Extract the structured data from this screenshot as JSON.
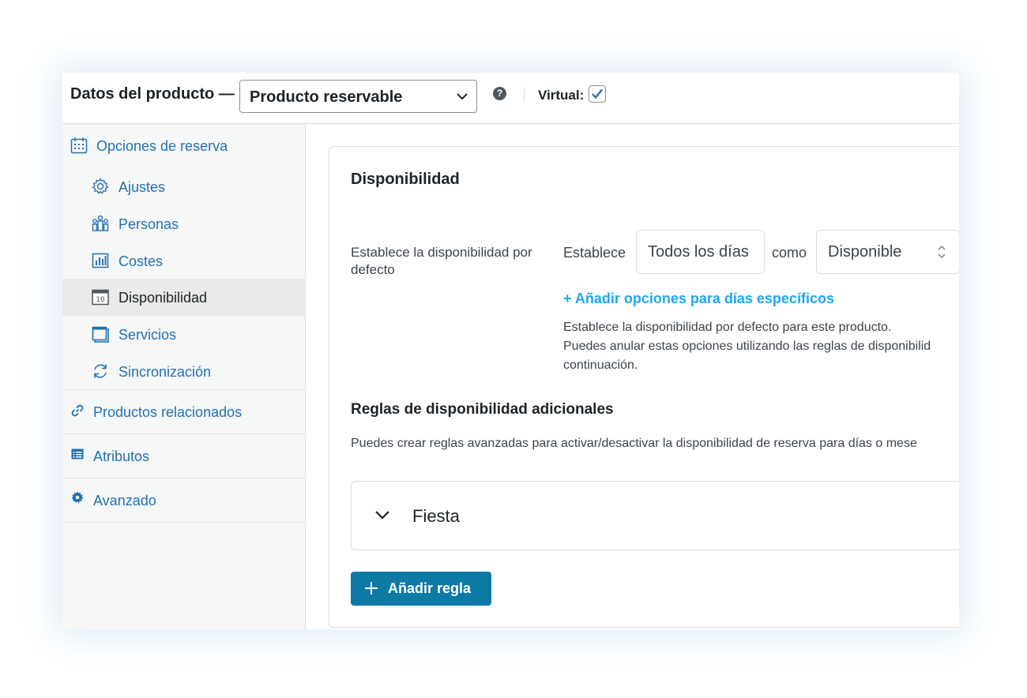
{
  "header": {
    "title": "Datos del producto —",
    "product_type": "Producto reservable",
    "help_icon": "question-circle-icon",
    "virtual_label": "Virtual:",
    "virtual_checked": true
  },
  "sidebar": {
    "items": [
      {
        "label": "Opciones de reserva",
        "icon": "calendar-icon"
      },
      {
        "label": "Ajustes",
        "icon": "gear-icon"
      },
      {
        "label": "Personas",
        "icon": "people-icon"
      },
      {
        "label": "Costes",
        "icon": "bar-chart-icon"
      },
      {
        "label": "Disponibilidad",
        "icon": "calendar-day-icon",
        "active": true
      },
      {
        "label": "Servicios",
        "icon": "window-icon"
      },
      {
        "label": "Sincronización",
        "icon": "sync-icon"
      },
      {
        "label": "Productos relacionados",
        "icon": "link-icon"
      },
      {
        "label": "Atributos",
        "icon": "list-card-icon"
      },
      {
        "label": "Avanzado",
        "icon": "cog-icon"
      }
    ]
  },
  "main": {
    "title": "Disponibilidad",
    "default_label": "Establece la disponibilidad por defecto",
    "word_set": "Establece",
    "days_value": "Todos los días",
    "word_as": "como",
    "availability_value": "Disponible",
    "add_specific_link": "+ Añadir opciones para días específicos",
    "description_lines": [
      "Establece la disponibilidad por defecto para este producto.",
      "Puedes anular estas opciones utilizando las reglas de disponibilid",
      "continuación."
    ],
    "rules_title": "Reglas de disponibilidad adicionales",
    "rules_description": "Puedes crear reglas avanzadas para activar/desactivar la disponibilidad de reserva para días o mese",
    "rule_name": "Fiesta",
    "add_rule_button": "Añadir regla"
  },
  "colors": {
    "link": "#2271b1",
    "accent_link": "#1ea7f3",
    "button": "#0c7aa4",
    "sidebar_bg": "#f6f7f7",
    "active_item_bg": "#eaeaea"
  }
}
